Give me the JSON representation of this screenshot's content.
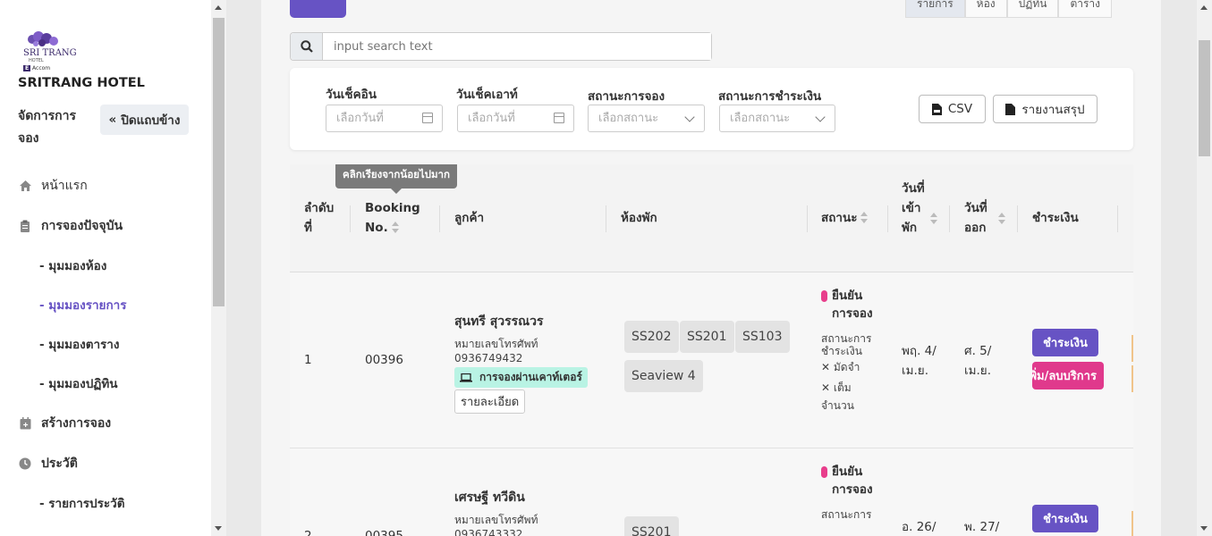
{
  "brand": {
    "logo_text": "SRI TRANG",
    "logo_sub": "HOTEL",
    "logo_tag": "Accom",
    "hotel_name": "SRITRANG HOTEL"
  },
  "sidebar": {
    "title": "จัดการการจอง",
    "collapse_label": "ปิดแถบข้าง",
    "items": [
      {
        "label": "หน้าแรก",
        "icon": "home-icon"
      },
      {
        "label": "การจองปัจจุบัน",
        "icon": "clipboard-icon"
      },
      {
        "label": "สร้างการจอง",
        "icon": "calendar-plus-icon"
      },
      {
        "label": "ประวัติ",
        "icon": "clock-icon"
      }
    ],
    "sub_items_current": [
      "- มุมมองห้อง",
      "- มุมมองรายการ",
      "- มุมมองตาราง",
      "- มุมมองปฏิทิน"
    ],
    "sub_items_history": [
      "- รายการประวัติ"
    ],
    "active_sub": "- มุมมองรายการ"
  },
  "view_tabs": [
    "รายการ",
    "ห้อง",
    "ปฏิทิน",
    "ตาราง"
  ],
  "search": {
    "placeholder": "input search text"
  },
  "filters": {
    "checkin_label": "วันเช็คอิน",
    "checkin_placeholder": "เลือกวันที่",
    "checkout_label": "วันเช็คเอาท์",
    "checkout_placeholder": "เลือกวันที่",
    "booking_status_label": "สถานะการจอง",
    "booking_status_placeholder": "เลือกสถานะ",
    "payment_status_label": "สถานะการชำระเงิน",
    "payment_status_placeholder": "เลือกสถานะ",
    "csv_label": "CSV",
    "report_label": "รายงานสรุป"
  },
  "table": {
    "tooltip": "คลิกเรียงจากน้อยไปมาก",
    "headers": {
      "no": "ลำดับที่",
      "booking_no": "Booking No.",
      "customer": "ลูกค้า",
      "room": "ห้องพัก",
      "status": "สถานะ",
      "checkin": "วันที่เข้าพัก",
      "checkout": "วันที่ออก",
      "payment": "ชำระเงิน"
    },
    "rows": [
      {
        "no": "1",
        "booking_no": "00396",
        "customer": "สุนทรี สุวรรณวร",
        "phone_label": "หมายเลขโทรศัพท์",
        "phone": "0936749432",
        "channel": "การจองผ่านเคาท์เตอร์",
        "detail": "รายละเอียด",
        "rooms": [
          "SS202",
          "SS201",
          "SS103",
          "Seaview 4"
        ],
        "status": "ยืนยันการจอง",
        "pay_status_label": "สถานะการชำระเงิน",
        "deposit": "✕ มัดจำ",
        "full": "✕ เต็มจำนวน",
        "checkin": "พฤ. 4/ เม.ย.",
        "checkout": "ศ. 5/ เม.ย.",
        "pay_btn": "ชำระเงิน",
        "svc_btn": "เพิ่ม/ลบบริการ"
      },
      {
        "no": "2",
        "booking_no": "00395",
        "customer": "เศรษฐี ทวีดิน",
        "phone_label": "หมายเลขโทรศัพท์",
        "phone": "0936743332",
        "rooms": [
          "SS201"
        ],
        "status": "ยืนยันการจอง",
        "pay_status_label": "สถานะการ",
        "checkin": "อ. 26/",
        "checkout": "พ. 27/",
        "pay_btn": "ชำระเงิน"
      }
    ]
  },
  "colors": {
    "primary": "#6753c4",
    "pink": "#e0398c",
    "teal_badge": "#b9f3e4"
  }
}
